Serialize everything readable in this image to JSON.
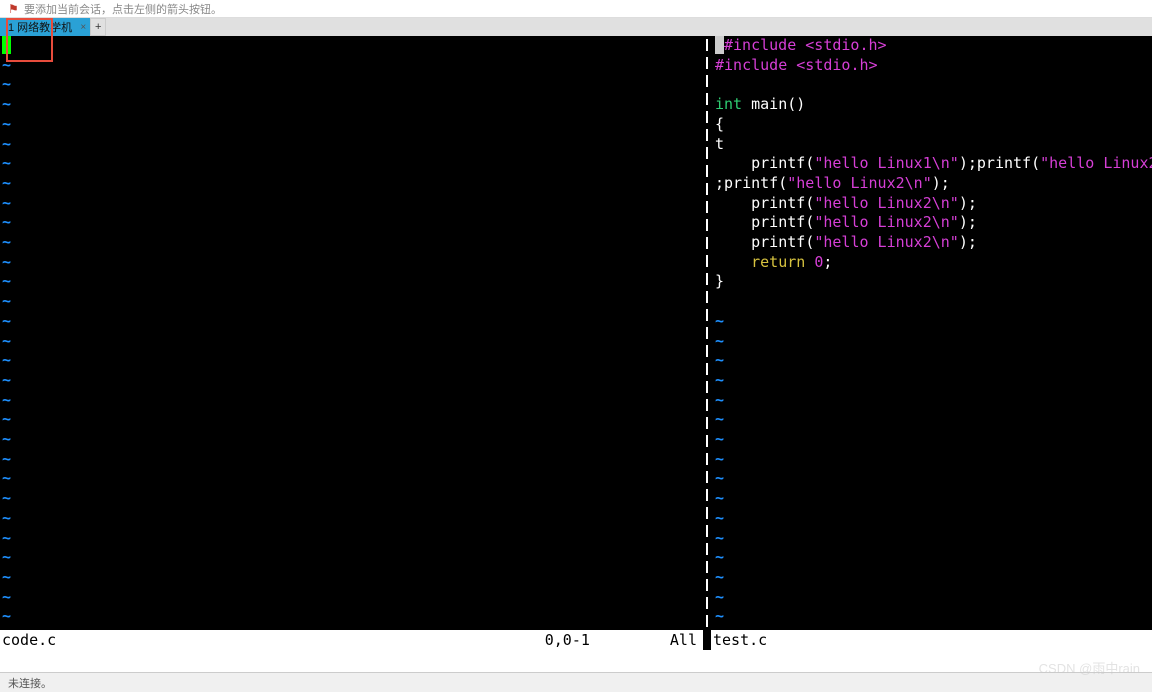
{
  "hint": {
    "text": "要添加当前会话，点击左侧的箭头按钮。"
  },
  "tabs": {
    "active_label": "1 网络教学机",
    "close": "×",
    "add": "+"
  },
  "left_pane": {
    "filename": "code.c",
    "cursor_pos": "0,0-1",
    "scroll": "All"
  },
  "right_pane": {
    "filename": "test.c",
    "code": {
      "inc1_a": "#include ",
      "inc1_b": "<stdio.h>",
      "inc2_a": "#include ",
      "inc2_b": "<stdio.h>",
      "type_int": "int",
      "main_sig": " main()",
      "brace_open": "{",
      "t_line": "t",
      "printf_kw": "printf",
      "hello1": "\"hello Linux1\\n\"",
      "hello2": "\"hello Linux2\\n\"",
      "hello2b": "\"hello Linux2\\",
      "return_kw": "return",
      "zero": " 0",
      "brace_close": "}",
      "indent4": "    ",
      "indent6": "      ",
      "semi_outer": ";",
      "close_paren_semi": ");",
      "open_paren": "("
    }
  },
  "footer": {
    "status": "未连接。"
  },
  "watermark": "CSDN @雨中rain",
  "tilde": "~"
}
